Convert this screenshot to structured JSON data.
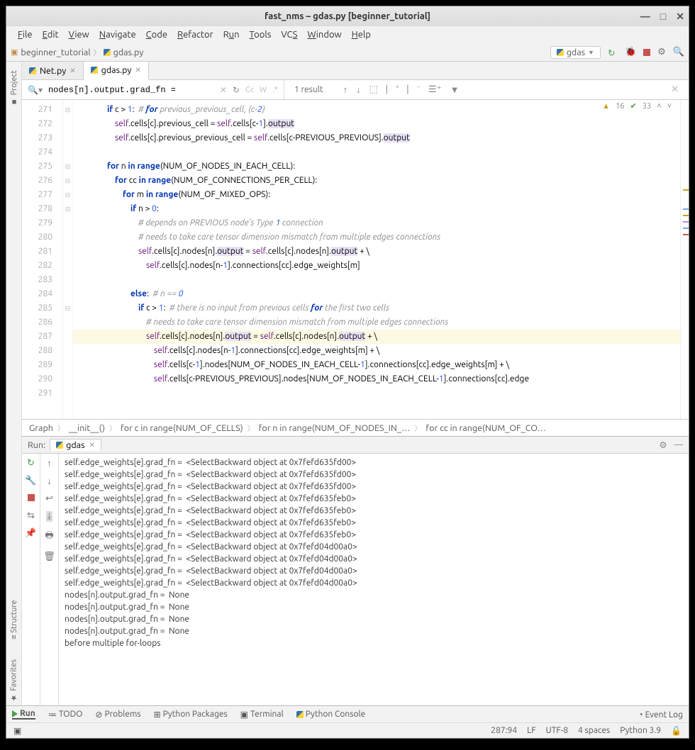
{
  "window": {
    "title": "fast_nms – gdas.py [beginner_tutorial]"
  },
  "menu": {
    "file": "File",
    "edit": "Edit",
    "view": "View",
    "navigate": "Navigate",
    "code": "Code",
    "refactor": "Refactor",
    "run": "Run",
    "tools": "Tools",
    "vcs": "VCS",
    "window": "Window",
    "help": "Help"
  },
  "breadcrumb": {
    "root": "beginner_tutorial",
    "file": "gdas.py"
  },
  "run_config": {
    "name": "gdas"
  },
  "tabs": [
    {
      "label": "Net.py"
    },
    {
      "label": "gdas.py"
    }
  ],
  "find": {
    "query": "nodes[n].output.grad_fn =",
    "result": "1 result"
  },
  "inspections": {
    "warn": "16",
    "ok": "33"
  },
  "code_lines": [
    {
      "n": "271",
      "fold": "⊟",
      "txt": "                if c > 1:  # for previous_previous_cell, (c-2)"
    },
    {
      "n": "272",
      "fold": "",
      "txt": "                    self.cells[c].previous_cell = self.cells[c-1].output"
    },
    {
      "n": "273",
      "fold": "",
      "txt": "                    self.cells[c].previous_previous_cell = self.cells[c-PREVIOUS_PREVIOUS].output"
    },
    {
      "n": "274",
      "fold": "",
      "txt": ""
    },
    {
      "n": "275",
      "fold": "⊟",
      "txt": "                for n in range(NUM_OF_NODES_IN_EACH_CELL):"
    },
    {
      "n": "276",
      "fold": "⊟",
      "txt": "                    for cc in range(NUM_OF_CONNECTIONS_PER_CELL):"
    },
    {
      "n": "277",
      "fold": "⊟",
      "txt": "                        for m in range(NUM_OF_MIXED_OPS):"
    },
    {
      "n": "278",
      "fold": "⊟",
      "txt": "                            if n > 0:"
    },
    {
      "n": "279",
      "fold": "",
      "txt": "                                # depends on PREVIOUS node's Type 1 connection"
    },
    {
      "n": "280",
      "fold": "",
      "txt": "                                # needs to take care tensor dimension mismatch from multiple edges connections"
    },
    {
      "n": "281",
      "fold": "",
      "txt": "                                self.cells[c].nodes[n].output = self.cells[c].nodes[n].output + \\"
    },
    {
      "n": "282",
      "fold": "",
      "txt": "                                    self.cells[c].nodes[n-1].connections[cc].edge_weights[m]"
    },
    {
      "n": "283",
      "fold": "",
      "txt": ""
    },
    {
      "n": "284",
      "fold": "",
      "txt": "                            else:  # n == 0"
    },
    {
      "n": "285",
      "fold": "⊟",
      "txt": "                                if c > 1:  # there is no input from previous cells for the first two cells"
    },
    {
      "n": "286",
      "fold": "",
      "txt": "                                    # needs to take care tensor dimension mismatch from multiple edges connections"
    },
    {
      "n": "287",
      "fold": "",
      "txt": "                                    self.cells[c].nodes[n].output = self.cells[c].nodes[n].output + \\",
      "hl": true
    },
    {
      "n": "288",
      "fold": "",
      "txt": "                                        self.cells[c].nodes[n-1].connections[cc].edge_weights[m] + \\"
    },
    {
      "n": "289",
      "fold": "",
      "txt": "                                        self.cells[c-1].nodes[NUM_OF_NODES_IN_EACH_CELL-1].connections[cc].edge_weights[m] + \\"
    },
    {
      "n": "290",
      "fold": "",
      "txt": "                                        self.cells[c-PREVIOUS_PREVIOUS].nodes[NUM_OF_NODES_IN_EACH_CELL-1].connections[cc].edge"
    },
    {
      "n": "291",
      "fold": "",
      "txt": ""
    }
  ],
  "code_crumbs": [
    "Graph",
    "__init__()",
    "for c in range(NUM_OF_CELLS)",
    "for n in range(NUM_OF_NODES_IN_…",
    "for cc in range(NUM_OF_CO…"
  ],
  "run": {
    "label": "Run:",
    "tab": "gdas",
    "lines": [
      "self.edge_weights[e].grad_fn =  <SelectBackward object at 0x7fefd635fd00>",
      "self.edge_weights[e].grad_fn =  <SelectBackward object at 0x7fefd635fd00>",
      "self.edge_weights[e].grad_fn =  <SelectBackward object at 0x7fefd635fd00>",
      "self.edge_weights[e].grad_fn =  <SelectBackward object at 0x7fefd635feb0>",
      "self.edge_weights[e].grad_fn =  <SelectBackward object at 0x7fefd635feb0>",
      "self.edge_weights[e].grad_fn =  <SelectBackward object at 0x7fefd635feb0>",
      "self.edge_weights[e].grad_fn =  <SelectBackward object at 0x7fefd635feb0>",
      "self.edge_weights[e].grad_fn =  <SelectBackward object at 0x7fefd04d00a0>",
      "self.edge_weights[e].grad_fn =  <SelectBackward object at 0x7fefd04d00a0>",
      "self.edge_weights[e].grad_fn =  <SelectBackward object at 0x7fefd04d00a0>",
      "self.edge_weights[e].grad_fn =  <SelectBackward object at 0x7fefd04d00a0>",
      "nodes[n].output.grad_fn =  None",
      "nodes[n].output.grad_fn =  None",
      "nodes[n].output.grad_fn =  None",
      "nodes[n].output.grad_fn =  None",
      "before multiple for-loops"
    ]
  },
  "bottom": {
    "run": "Run",
    "todo": "TODO",
    "problems": "Problems",
    "pkgs": "Python Packages",
    "terminal": "Terminal",
    "pycon": "Python Console",
    "eventlog": "Event Log"
  },
  "status": {
    "pos": "287:94",
    "lf": "LF",
    "enc": "UTF-8",
    "indent": "4 spaces",
    "py": "Python 3.9"
  },
  "side": {
    "project": "Project",
    "structure": "Structure",
    "favorites": "Favorites"
  }
}
